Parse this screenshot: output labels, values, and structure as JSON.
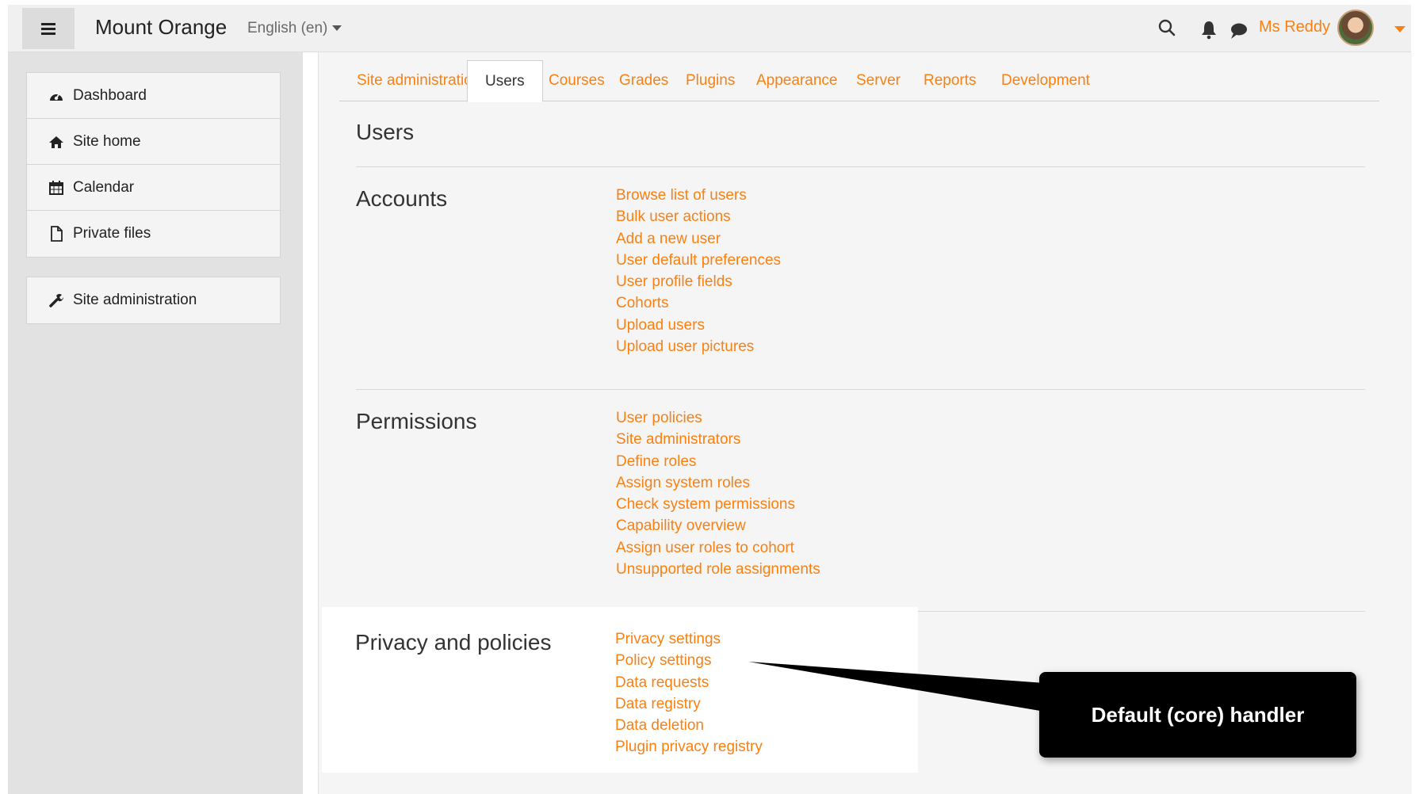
{
  "navbar": {
    "brand": "Mount Orange",
    "language": "English (en)",
    "user_name": "Ms Reddy",
    "icons": [
      "menu-icon",
      "search-icon",
      "bell-icon",
      "chat-icon"
    ],
    "accent_color": "#f98012"
  },
  "drawer": {
    "group1": [
      {
        "label": "Dashboard",
        "icon": "dashboard-icon"
      },
      {
        "label": "Site home",
        "icon": "home-icon"
      },
      {
        "label": "Calendar",
        "icon": "calendar-icon"
      },
      {
        "label": "Private files",
        "icon": "file-icon"
      }
    ],
    "group2": [
      {
        "label": "Site administration",
        "icon": "wrench-icon"
      }
    ]
  },
  "tabs": [
    "Site administration",
    "Users",
    "Courses",
    "Grades",
    "Plugins",
    "Appearance",
    "Server",
    "Reports",
    "Development"
  ],
  "active_tab": "Users",
  "page": {
    "heading": "Users",
    "sections": [
      {
        "title": "Accounts",
        "links": [
          "Browse list of users",
          "Bulk user actions",
          "Add a new user",
          "User default preferences",
          "User profile fields",
          "Cohorts",
          "Upload users",
          "Upload user pictures"
        ]
      },
      {
        "title": "Permissions",
        "links": [
          "User policies",
          "Site administrators",
          "Define roles",
          "Assign system roles",
          "Check system permissions",
          "Capability overview",
          "Assign user roles to cohort",
          "Unsupported role assignments"
        ]
      },
      {
        "title": "Privacy and policies",
        "links": [
          "Privacy settings",
          "Policy settings",
          "Data requests",
          "Data registry",
          "Data deletion",
          "Plugin privacy registry"
        ]
      }
    ]
  },
  "callout": {
    "text": "Default (core) handler"
  }
}
